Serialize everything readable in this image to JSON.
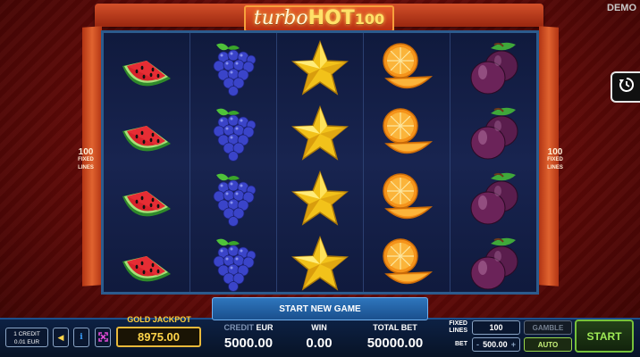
{
  "header": {
    "logo_part1": "turbo",
    "logo_part2": "HOT",
    "logo_part3": "100",
    "demo_label": "DEMO"
  },
  "side": {
    "fixed_lines_number": "100",
    "fixed_lines_word1": "FIXED",
    "fixed_lines_word2": "LINES"
  },
  "reels": [
    {
      "symbol": "watermelon",
      "rows": 4
    },
    {
      "symbol": "grapes",
      "rows": 4
    },
    {
      "symbol": "star",
      "rows": 4
    },
    {
      "symbol": "orange",
      "rows": 4
    },
    {
      "symbol": "plum",
      "rows": 4
    }
  ],
  "icons": {
    "replay": "replay-icon",
    "sound": "speaker-icon",
    "info": "info-icon",
    "fullscreen": "fullscreen-icon"
  },
  "bottom": {
    "start_new_game": "START NEW GAME",
    "credit_line1": "1 CREDIT",
    "credit_line2": "0.01 EUR",
    "gold_jackpot_label": "GOLD JACKPOT",
    "gold_jackpot_value": "8975.00",
    "credit_label": "CREDIT",
    "credit_currency": "EUR",
    "credit_value": "5000.00",
    "win_label": "WIN",
    "win_value": "0.00",
    "total_bet_label": "TOTAL BET",
    "total_bet_value": "50000.00",
    "fixed_lines_label1": "FIXED",
    "fixed_lines_label2": "LINES",
    "fixed_lines_value": "100",
    "bet_label": "BET",
    "bet_value": "500.00",
    "bet_minus": "-",
    "bet_plus": "+",
    "gamble_label": "GAMBLE",
    "auto_label": "AUTO",
    "start_label": "START"
  },
  "colors": {
    "accent_gold": "#ffd54a",
    "start_green": "#76c23a",
    "frame_blue": "#2c5b8d"
  }
}
